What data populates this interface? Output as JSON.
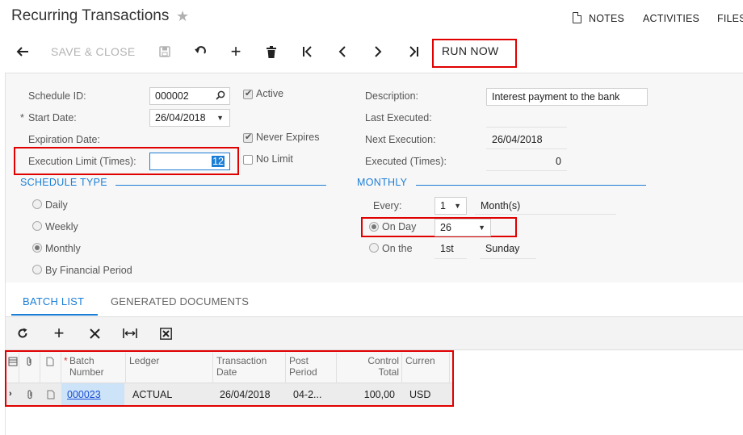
{
  "header": {
    "title": "Recurring Transactions",
    "links": {
      "notes": "NOTES",
      "activities": "ACTIVITIES",
      "files": "FILES"
    }
  },
  "toolbar": {
    "save_close": "SAVE & CLOSE",
    "run_now": "RUN NOW"
  },
  "form": {
    "schedule_id": {
      "label": "Schedule ID:",
      "value": "000002"
    },
    "active": {
      "label": "Active",
      "checked": true
    },
    "start_date": {
      "label": "Start Date:",
      "required_mark": "*",
      "value": "26/04/2018"
    },
    "expiration_date": {
      "label": "Expiration Date:"
    },
    "never_expires": {
      "label": "Never Expires",
      "checked": true
    },
    "execution_limit": {
      "label": "Execution Limit (Times):",
      "value": "12"
    },
    "no_limit": {
      "label": "No Limit",
      "checked": false
    },
    "description": {
      "label": "Description:",
      "value": "Interest payment to the bank"
    },
    "last_executed": {
      "label": "Last Executed:"
    },
    "next_execution": {
      "label": "Next Execution:",
      "value": "26/04/2018"
    },
    "executed_times": {
      "label": "Executed (Times):",
      "value": "0"
    }
  },
  "schedule_type": {
    "title": "SCHEDULE TYPE",
    "options": [
      "Daily",
      "Weekly",
      "Monthly",
      "By Financial Period"
    ],
    "selected": "Monthly"
  },
  "monthly": {
    "title": "MONTHLY",
    "every_label": "Every:",
    "every_value": "1",
    "every_unit": "Month(s)",
    "on_day_label": "On Day",
    "on_day_value": "26",
    "on_the_label": "On the",
    "on_the_ordinal": "1st",
    "on_the_weekday": "Sunday",
    "selected": "On Day"
  },
  "tabs": {
    "batch_list": "BATCH LIST",
    "generated_documents": "GENERATED DOCUMENTS",
    "active": "BATCH LIST"
  },
  "grid": {
    "columns": {
      "required_mark": "*",
      "batch_number_1": "Batch",
      "batch_number_2": "Number",
      "ledger": "Ledger",
      "transaction_date_1": "Transaction",
      "transaction_date_2": "Date",
      "post_period_1": "Post",
      "post_period_2": "Period",
      "control_total_1": "Control",
      "control_total_2": "Total",
      "currency": "Curren"
    },
    "rows": [
      {
        "batch_number": "000023",
        "ledger": "ACTUAL",
        "transaction_date": "26/04/2018",
        "post_period": "04-2...",
        "control_total": "100,00",
        "currency": "USD"
      }
    ]
  },
  "colors": {
    "accent": "#1b7ed6",
    "highlight_border": "#e00000",
    "link": "#1a4ed8"
  }
}
